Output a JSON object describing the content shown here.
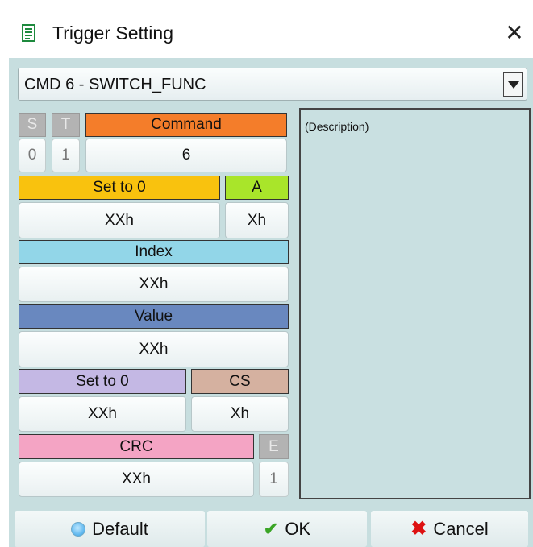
{
  "window": {
    "title": "Trigger Setting",
    "close_glyph": "✕",
    "icon": "document-icon"
  },
  "command_select": {
    "value": "CMD 6 - SWITCH_FUNC"
  },
  "fields": {
    "s": {
      "label": "S",
      "value": "0"
    },
    "t": {
      "label": "T",
      "value": "1"
    },
    "command": {
      "label": "Command",
      "value": "6",
      "color": "#f47d2a"
    },
    "set_to_0_a": {
      "label": "Set to 0",
      "value": "XXh",
      "color": "#f9c20e"
    },
    "a": {
      "label": "A",
      "value": "Xh",
      "color": "#a9e52a"
    },
    "index": {
      "label": "Index",
      "value": "XXh",
      "color": "#92d6e8"
    },
    "value": {
      "label": "Value",
      "value": "XXh",
      "color": "#6988bf"
    },
    "set_to_0_b": {
      "label": "Set to 0",
      "value": "XXh",
      "color": "#c4b8e4"
    },
    "cs": {
      "label": "CS",
      "value": "Xh",
      "color": "#d5b1a0"
    },
    "crc": {
      "label": "CRC",
      "value": "XXh",
      "color": "#f4a4c4"
    },
    "e": {
      "label": "E",
      "value": "1"
    }
  },
  "description": {
    "text": "(Description)"
  },
  "buttons": {
    "default": "Default",
    "ok": "OK",
    "cancel": "Cancel"
  }
}
